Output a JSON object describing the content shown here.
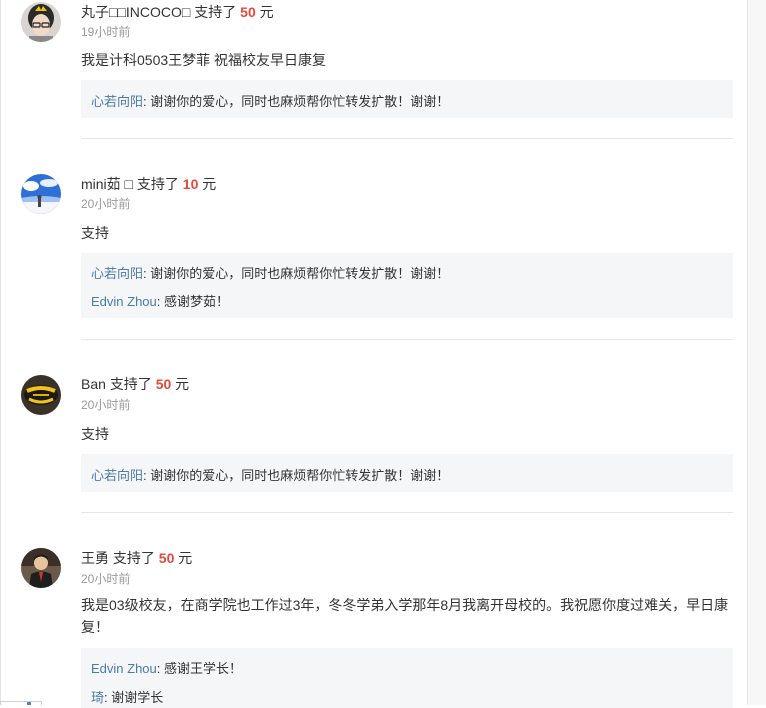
{
  "comments": [
    {
      "name": "丸子□□INCOCO□",
      "action": "支持了",
      "amount": "50",
      "unit": "元",
      "time": "19小时前",
      "content": "我是计科0503王梦菲 祝福校友早日康复",
      "replies": [
        {
          "who": "心若向阳",
          "sep": ":",
          "text": "谢谢你的爱心，同时也麻烦帮你忙转发扩散！谢谢！"
        }
      ]
    },
    {
      "name": "mini茹 □",
      "action": "支持了",
      "amount": "10",
      "unit": "元",
      "time": "20小时前",
      "content": "支持",
      "replies": [
        {
          "who": "心若向阳",
          "sep": ":",
          "text": "谢谢你的爱心，同时也麻烦帮你忙转发扩散！谢谢！"
        },
        {
          "who": "Edvin Zhou",
          "sep": ":",
          "text": "感谢梦茹！"
        }
      ]
    },
    {
      "name": "Ban",
      "action": "支持了",
      "amount": "50",
      "unit": "元",
      "time": "20小时前",
      "content": "支持",
      "replies": [
        {
          "who": "心若向阳",
          "sep": ":",
          "text": "谢谢你的爱心，同时也麻烦帮你忙转发扩散！谢谢！"
        }
      ]
    },
    {
      "name": "王勇",
      "action": "支持了",
      "amount": "50",
      "unit": "元",
      "time": "20小时前",
      "content": "我是03级校友，在商学院也工作过3年，冬冬学弟入学那年8月我离开母校的。我祝愿你度过难关，早日康复！",
      "replies": [
        {
          "who": "Edvin Zhou",
          "sep": ":",
          "text": "感谢王学长！"
        },
        {
          "who": "琦",
          "sep": ":",
          "text": "谢谢学长"
        }
      ]
    }
  ]
}
